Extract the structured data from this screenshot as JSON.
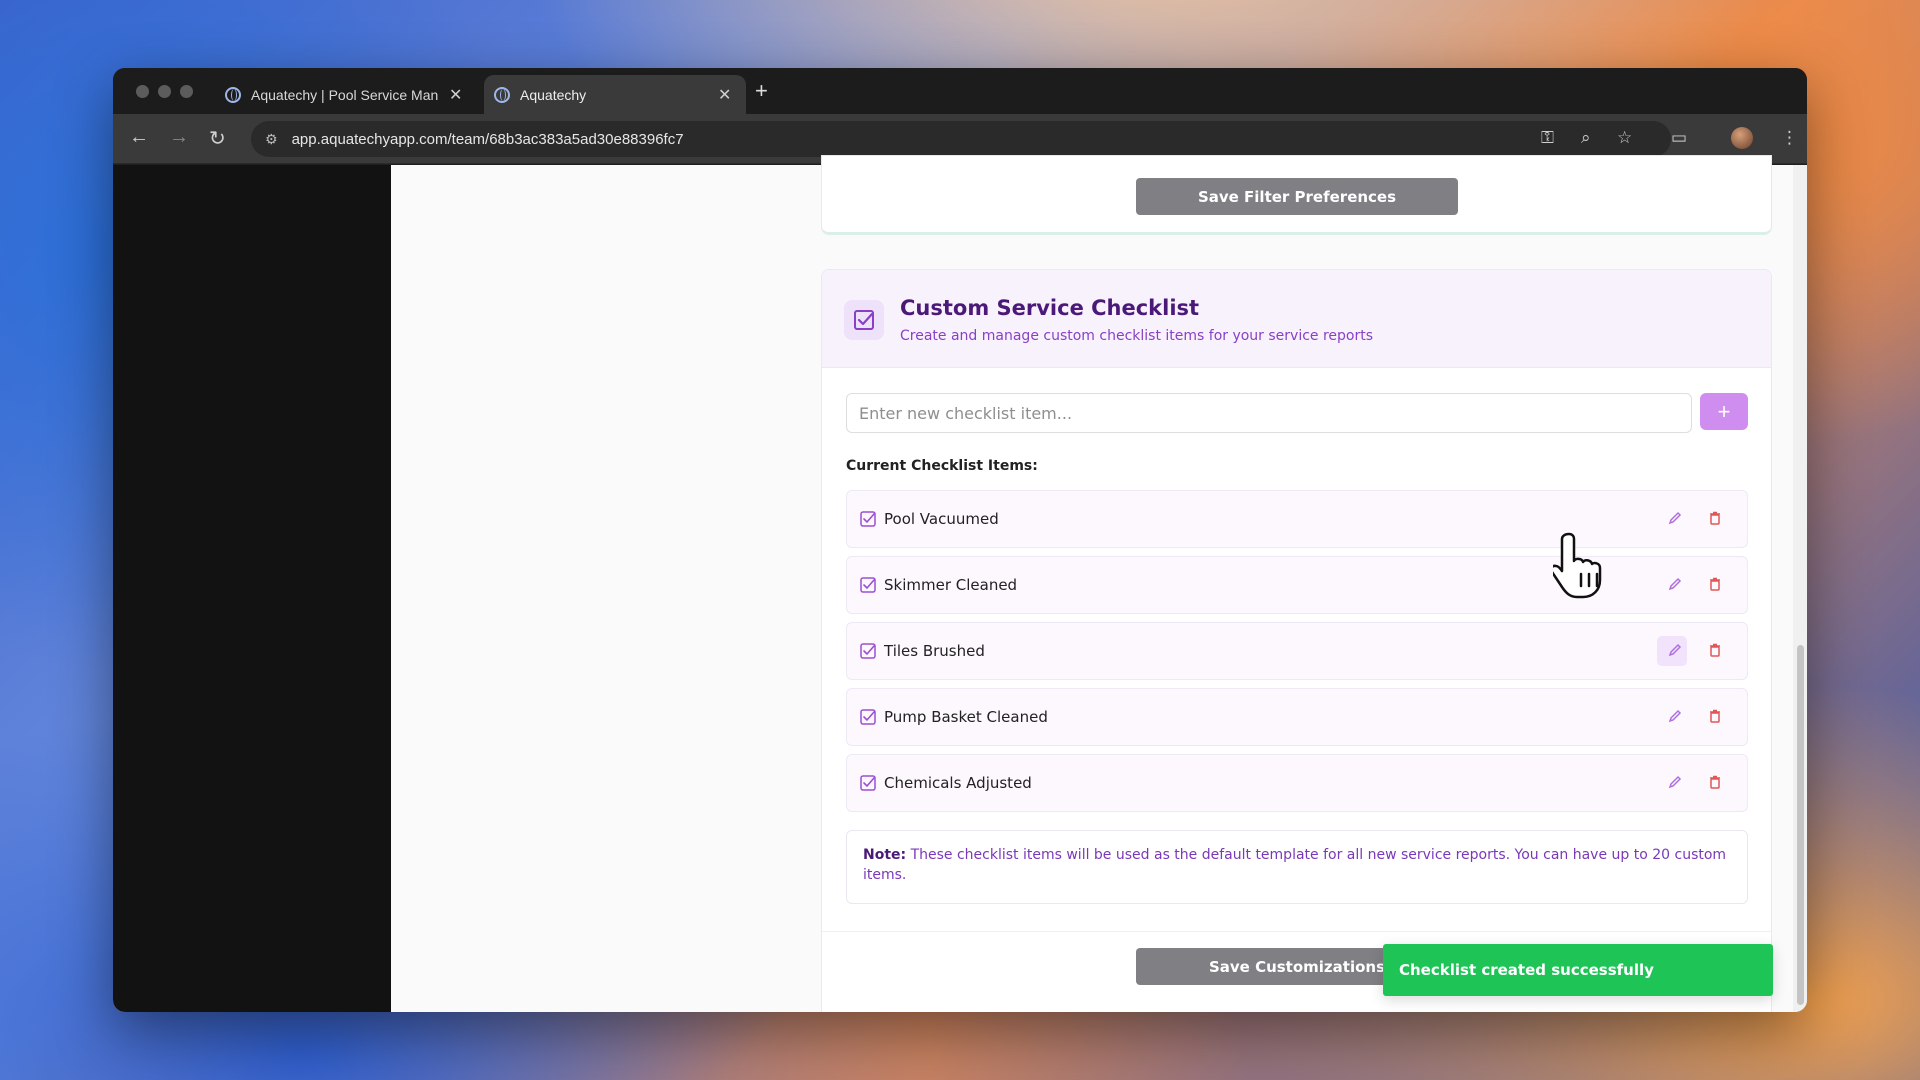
{
  "browser": {
    "tabs": [
      {
        "title": "Aquatechy | Pool Service Man",
        "close": "✕"
      },
      {
        "title": "Aquatechy",
        "close": "✕"
      }
    ],
    "new_tab": "+",
    "url": "app.aquatechyapp.com/team/68b3ac383a5ad30e88396fc7"
  },
  "filter_section": {
    "save_button": "Save Filter Preferences"
  },
  "checklist": {
    "title": "Custom Service Checklist",
    "subtitle": "Create and manage custom checklist items for your service reports",
    "input_placeholder": "Enter new checklist item...",
    "add_button": "+",
    "list_heading": "Current Checklist Items:",
    "items": [
      {
        "label": "Pool Vacuumed"
      },
      {
        "label": "Skimmer Cleaned"
      },
      {
        "label": "Tiles Brushed"
      },
      {
        "label": "Pump Basket Cleaned"
      },
      {
        "label": "Chemicals Adjusted"
      }
    ],
    "note_label": "Note:",
    "note_text": "These checklist items will be used as the default template for all new service reports. You can have up to 20 custom items.",
    "save_button": "Save Customizations"
  },
  "toast": {
    "message": "Checklist created successfully"
  },
  "colors": {
    "accent": "#cf8df0",
    "title": "#4b1a78",
    "toast": "#1fc457",
    "delete": "#e05757"
  }
}
